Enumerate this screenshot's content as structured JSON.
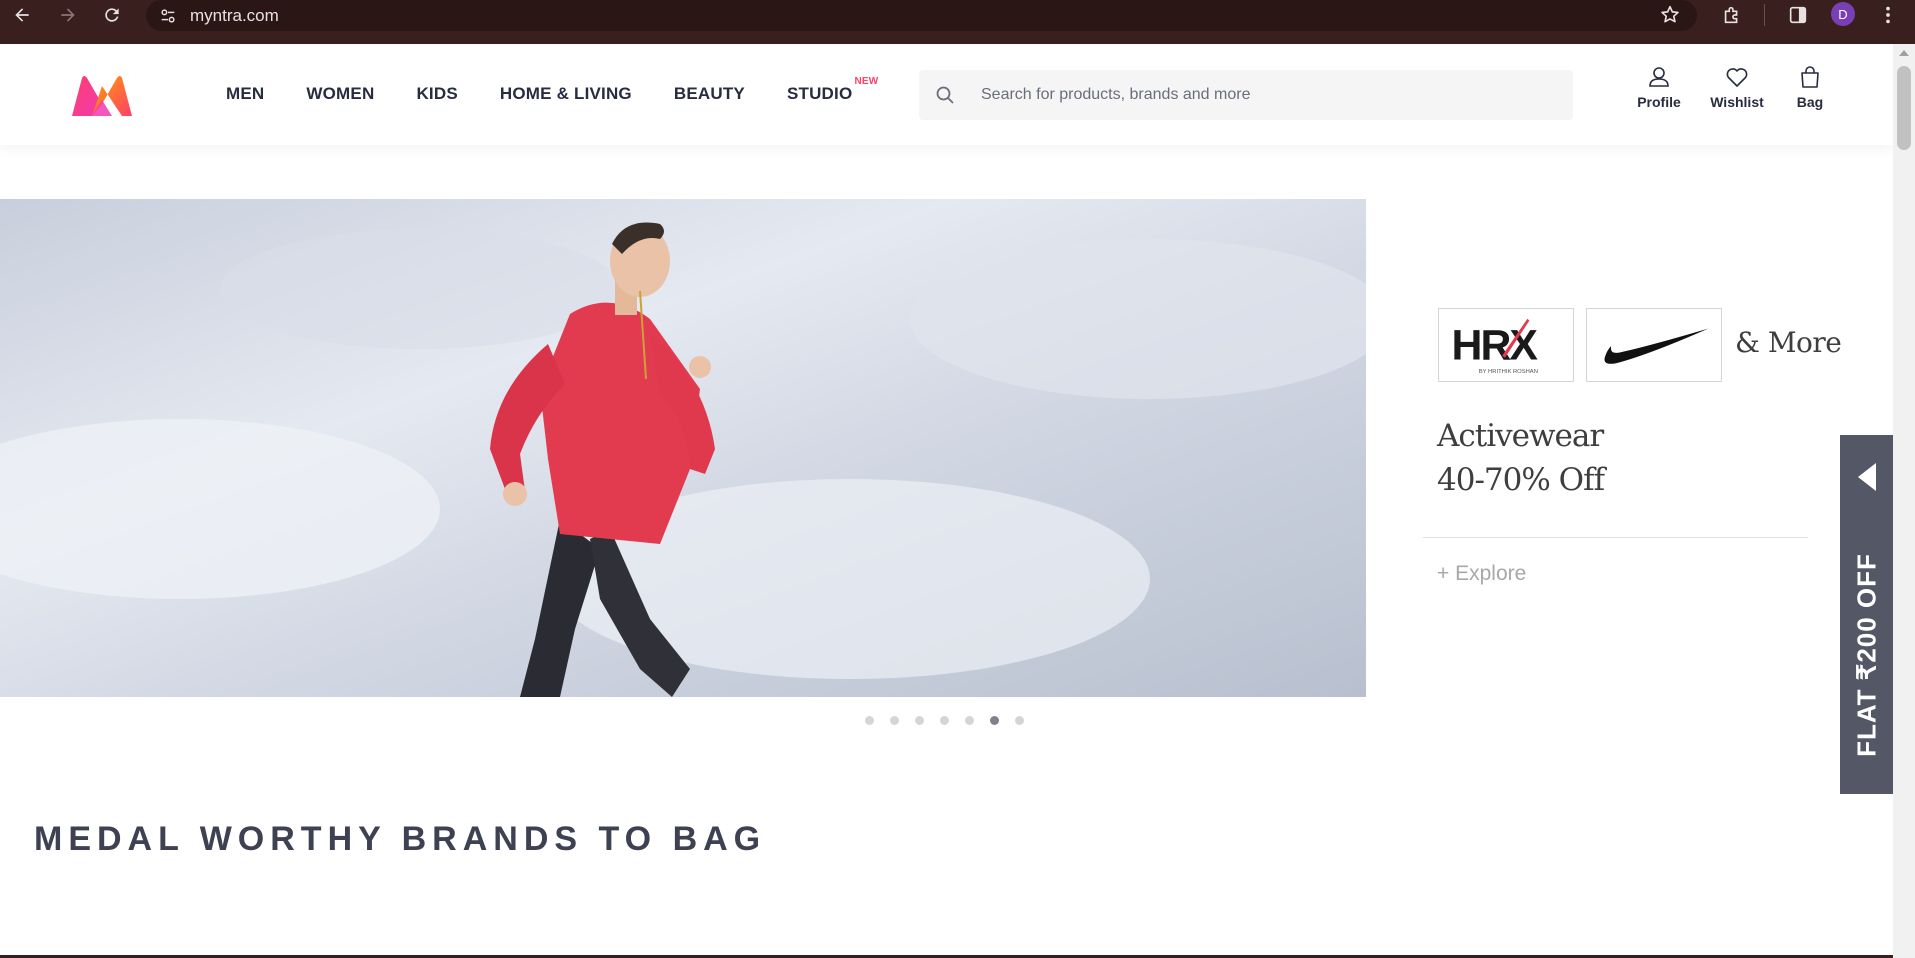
{
  "browser": {
    "url": "myntra.com",
    "profile_initial": "D",
    "icons": [
      "back-arrow-icon",
      "forward-arrow-icon",
      "reload-icon",
      "site-settings-icon",
      "bookmark-star-icon",
      "extensions-icon",
      "side-panel-icon",
      "more-vert-icon"
    ]
  },
  "header": {
    "nav": [
      {
        "label": "MEN"
      },
      {
        "label": "WOMEN"
      },
      {
        "label": "KIDS"
      },
      {
        "label": "HOME & LIVING"
      },
      {
        "label": "BEAUTY"
      },
      {
        "label": "STUDIO",
        "badge": "NEW"
      }
    ],
    "search": {
      "placeholder": "Search for products, brands and more"
    },
    "actions": [
      {
        "label": "Profile",
        "icon": "profile-icon"
      },
      {
        "label": "Wishlist",
        "icon": "heart-icon"
      },
      {
        "label": "Bag",
        "icon": "bag-icon"
      }
    ]
  },
  "hero": {
    "brands": [
      {
        "name": "HRX",
        "sub": "BY HRITHIK ROSHAN"
      },
      {
        "name": "Nike",
        "icon": "nike-swoosh-logo"
      }
    ],
    "and_more": "& More",
    "title_line1": "Activewear",
    "title_line2": "40-70% Off",
    "cta": "+ Explore",
    "carousel": {
      "count": 7,
      "active_index": 5
    }
  },
  "section": {
    "title": "MEDAL WORTHY BRANDS TO BAG"
  },
  "side_offer": {
    "text": "FLAT ₹200 OFF"
  },
  "colors": {
    "chrome_bg": "#3a1f1f",
    "brand_pink": "#ff3f6c",
    "text_dark": "#282c3f",
    "offer_tab_bg": "#535766",
    "shirt_red": "#e23a4e"
  }
}
